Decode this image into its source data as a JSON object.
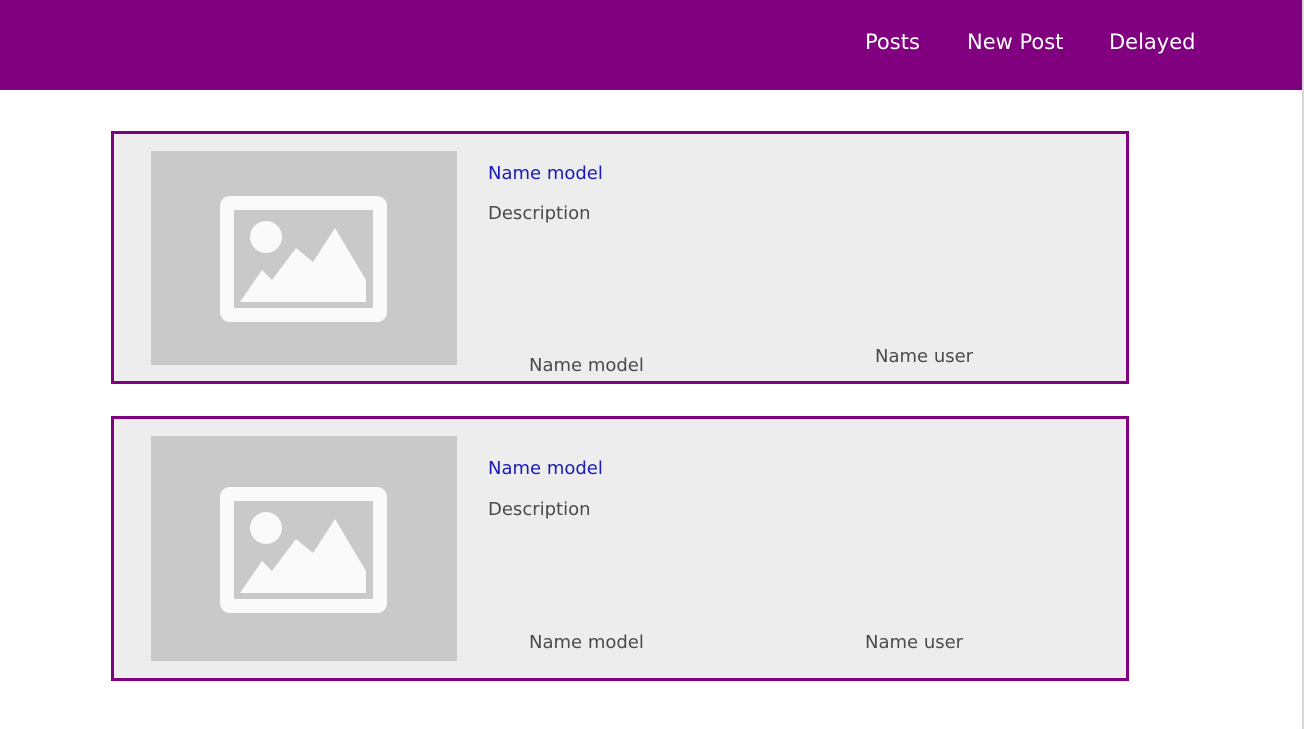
{
  "nav": {
    "links": [
      "Posts",
      "New Post",
      "Delayed"
    ]
  },
  "colors": {
    "brand": "#800080",
    "card_bg": "#ededed",
    "image_placeholder_bg": "#c9c9c9",
    "link": "#1a1ab8",
    "text": "#4a4a4a"
  },
  "posts": [
    {
      "title": "Name model",
      "description": "Description",
      "footer_model": "Name model",
      "footer_user": "Name user",
      "image_icon": "image-placeholder-icon"
    },
    {
      "title": "Name model",
      "description": "Description",
      "footer_model": "Name model",
      "footer_user": "Name user",
      "image_icon": "image-placeholder-icon"
    }
  ]
}
